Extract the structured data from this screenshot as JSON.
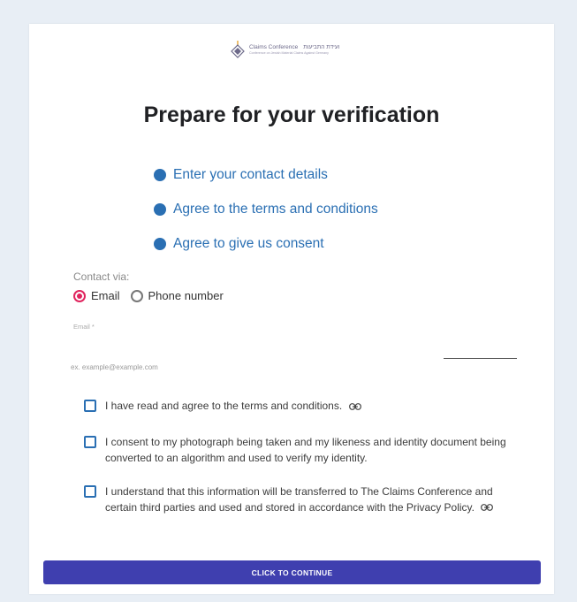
{
  "logo": {
    "text_primary": "Claims Conference",
    "text_hebrew": "ועידת התביעות",
    "text_secondary": "Conference on Jewish Material Claims Against Germany"
  },
  "page": {
    "title": "Prepare for your verification"
  },
  "steps": [
    {
      "label": "Enter your contact details"
    },
    {
      "label": "Agree to the terms and conditions"
    },
    {
      "label": "Agree to give us consent"
    }
  ],
  "contact": {
    "label": "Contact via:",
    "options": [
      {
        "label": "Email",
        "selected": true
      },
      {
        "label": "Phone number",
        "selected": false
      }
    ]
  },
  "email": {
    "label": "Email *",
    "value": "",
    "helper": "ex. example@example.com"
  },
  "consents": [
    {
      "text": "I have read and agree to the terms and conditions.",
      "checked": false,
      "has_link_icon": true
    },
    {
      "text": "I consent to my photograph being taken and my likeness and identity document being converted to an algorithm and used to verify my identity.",
      "checked": false,
      "has_link_icon": false
    },
    {
      "text": "I understand that this information will be transferred to The Claims Conference and certain third parties and used and stored in accordance with the Privacy Policy.",
      "checked": false,
      "has_link_icon": true
    }
  ],
  "continue_button": {
    "label": "CLICK TO CONTINUE"
  },
  "colors": {
    "background": "#e8eef5",
    "accent_blue": "#2a6fb3",
    "radio_selected": "#e0245e",
    "button": "#3f3faf"
  }
}
